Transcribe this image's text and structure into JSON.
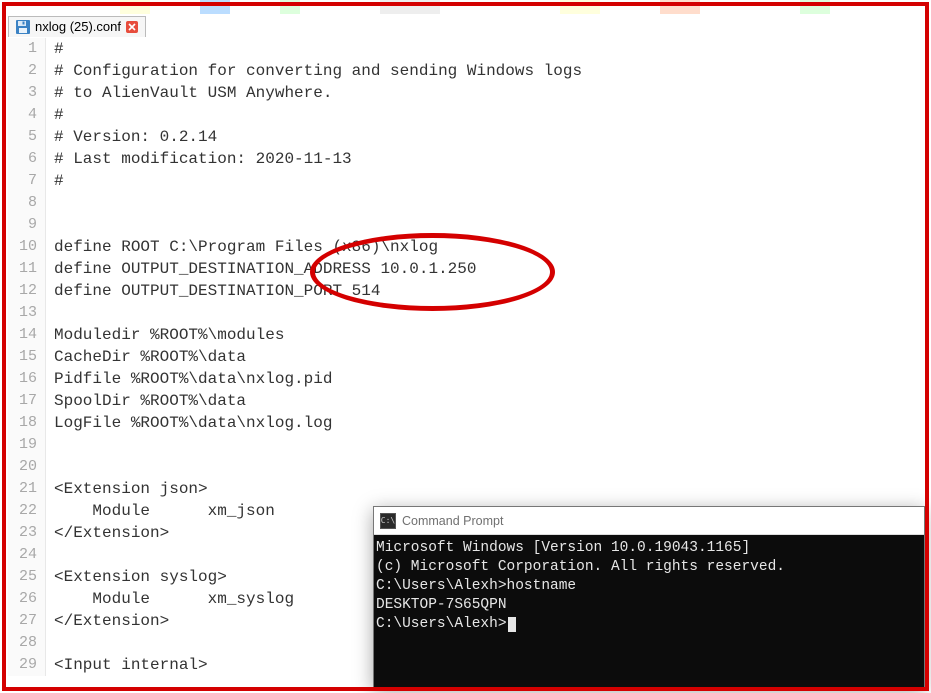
{
  "tab": {
    "filename": "nxlog (25).conf"
  },
  "code_lines": [
    "#",
    "# Configuration for converting and sending Windows logs",
    "# to AlienVault USM Anywhere.",
    "#",
    "# Version: 0.2.14",
    "# Last modification: 2020-11-13",
    "#",
    "",
    "",
    "define ROOT C:\\Program Files (x86)\\nxlog",
    "define OUTPUT_DESTINATION_ADDRESS 10.0.1.250",
    "define OUTPUT_DESTINATION_PORT 514",
    "",
    "Moduledir %ROOT%\\modules",
    "CacheDir %ROOT%\\data",
    "Pidfile %ROOT%\\data\\nxlog.pid",
    "SpoolDir %ROOT%\\data",
    "LogFile %ROOT%\\data\\nxlog.log",
    "",
    "",
    "<Extension json>",
    "    Module      xm_json",
    "</Extension>",
    "",
    "<Extension syslog>",
    "    Module      xm_syslog",
    "</Extension>",
    "",
    "<Input internal>"
  ],
  "cmd": {
    "title": "Command Prompt",
    "lines": [
      "Microsoft Windows [Version 10.0.19043.1165]",
      "(c) Microsoft Corporation. All rights reserved.",
      "",
      "C:\\Users\\Alexh>hostname",
      "DESKTOP-7S65QPN",
      "",
      "C:\\Users\\Alexh>"
    ]
  }
}
